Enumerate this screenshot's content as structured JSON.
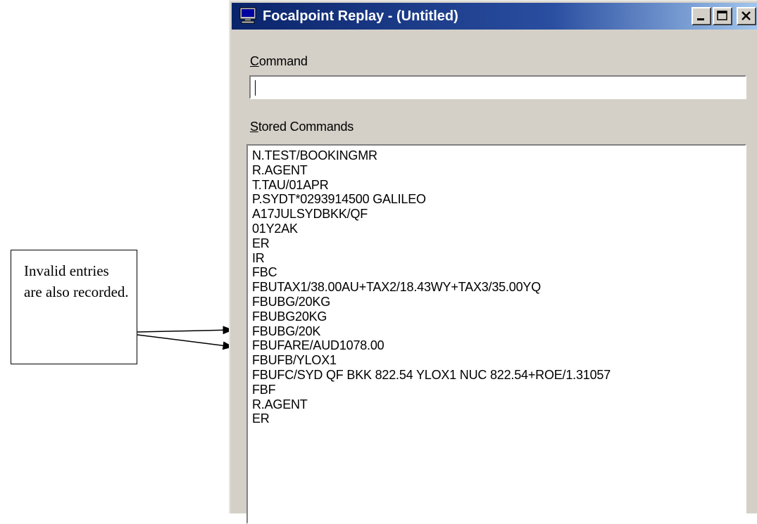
{
  "window": {
    "title": "Focalpoint Replay - (Untitled)",
    "buttons": {
      "minimize": "minimize-icon",
      "maximize": "maximize-icon",
      "close": "close-icon"
    }
  },
  "command": {
    "label_accel": "C",
    "label_rest": "ommand",
    "value": ""
  },
  "stored": {
    "label_accel": "S",
    "label_rest": "tored Commands",
    "items": [
      "N.TEST/BOOKINGMR",
      "R.AGENT",
      "T.TAU/01APR",
      "P.SYDT*0293914500 GALILEO",
      "A17JULSYDBKK/QF",
      "01Y2AK",
      "ER",
      "IR",
      "FBC",
      "FBUTAX1/38.00AU+TAX2/18.43WY+TAX3/35.00YQ",
      "FBUBG/20KG",
      "FBUBG20KG",
      "FBUBG/20K",
      "FBUFARE/AUD1078.00",
      "FBUFB/YLOX1",
      "FBUFC/SYD QF BKK 822.54 YLOX1 NUC 822.54+ROE/1.31057",
      "FBF",
      "R.AGENT",
      "ER"
    ]
  },
  "callout": {
    "text": "Invalid entries are also recorded."
  }
}
